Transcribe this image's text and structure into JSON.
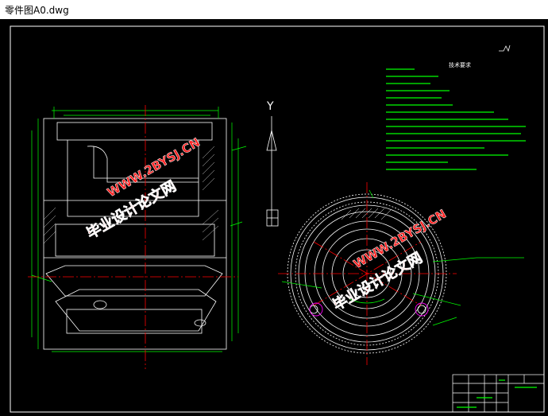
{
  "window": {
    "title": "零件图A0.dwg"
  },
  "drawing": {
    "tech_heading": "技术要求",
    "axis_label": "Y",
    "watermark": {
      "cn": "毕业设计论文网",
      "url": "WWW.2BYSJ.CN"
    }
  },
  "colors": {
    "background": "#000000",
    "lines": "#ffffff",
    "dimensions": "#00ff00",
    "centerlines": "#ff0000",
    "watermark_text": "#ff2020",
    "watermark_outline": "#ffffff",
    "hatch": "#ff00ff"
  }
}
